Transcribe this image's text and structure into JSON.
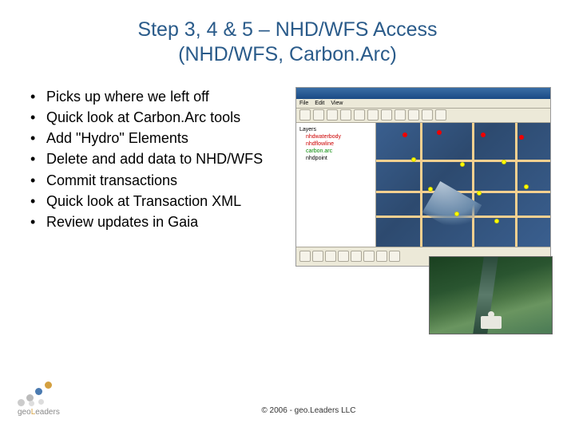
{
  "title_line1": "Step 3, 4 & 5 – NHD/WFS Access",
  "title_line2": "(NHD/WFS, Carbon.Arc)",
  "bullets": [
    "Picks up where we left off",
    "Quick look at Carbon.Arc tools",
    "Add \"Hydro\" Elements",
    "Delete and add data to NHD/WFS",
    "Commit transactions",
    "Quick look at Transaction XML",
    "Review updates in Gaia"
  ],
  "logo": {
    "prefix": "geo",
    "accent": "L",
    "suffix": "eaders"
  },
  "copyright": "© 2006 - geo.Leaders LLC",
  "map_layers": {
    "root": "Layers",
    "items": [
      "nhdwaterbody",
      "nhdflowline",
      "carbon.arc",
      "nhdpoint"
    ]
  }
}
